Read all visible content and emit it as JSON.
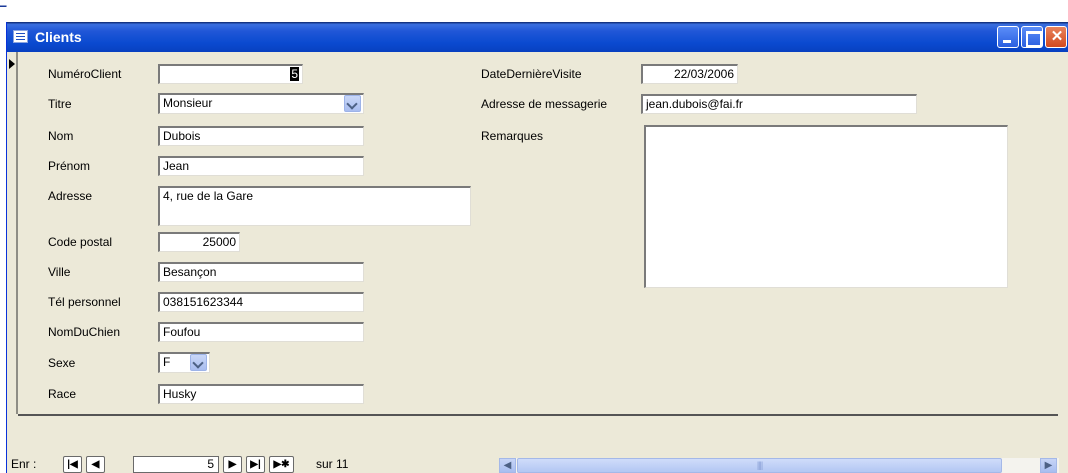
{
  "window": {
    "title": "Clients",
    "close_glyph": "✕"
  },
  "form": {
    "numero_client": {
      "label": "NuméroClient",
      "value": "5"
    },
    "titre": {
      "label": "Titre",
      "value": "Monsieur"
    },
    "nom": {
      "label": "Nom",
      "value": "Dubois"
    },
    "prenom": {
      "label": "Prénom",
      "value": "Jean"
    },
    "adresse": {
      "label": "Adresse",
      "value": "4, rue de la Gare"
    },
    "code_postal": {
      "label": "Code postal",
      "value": "25000"
    },
    "ville": {
      "label": "Ville",
      "value": "Besançon"
    },
    "tel": {
      "label": "Tél personnel",
      "value": "038151623344"
    },
    "nom_du_chien": {
      "label": "NomDuChien",
      "value": "Foufou"
    },
    "sexe": {
      "label": "Sexe",
      "value": "F"
    },
    "race": {
      "label": "Race",
      "value": "Husky"
    },
    "date_derniere_visite": {
      "label": "DateDernièreVisite",
      "value": "22/03/2006"
    },
    "adresse_messagerie": {
      "label": "Adresse de messagerie",
      "value": "jean.dubois@fai.fr"
    },
    "remarques": {
      "label": "Remarques",
      "value": ""
    }
  },
  "navigation": {
    "label": "Enr :",
    "first_glyph": "|◀",
    "prev_glyph": "◀",
    "current": "5",
    "next_glyph": "▶",
    "last_glyph": "▶|",
    "new_glyph": "▶✱",
    "total_text": "sur  11"
  },
  "scrollbar": {
    "left_glyph": "◀",
    "right_glyph": "▶",
    "grip": "||||"
  },
  "colors": {
    "titlebar": "#0a4ad0",
    "window_face": "#ece9d8",
    "close_button": "#d24a1f"
  }
}
